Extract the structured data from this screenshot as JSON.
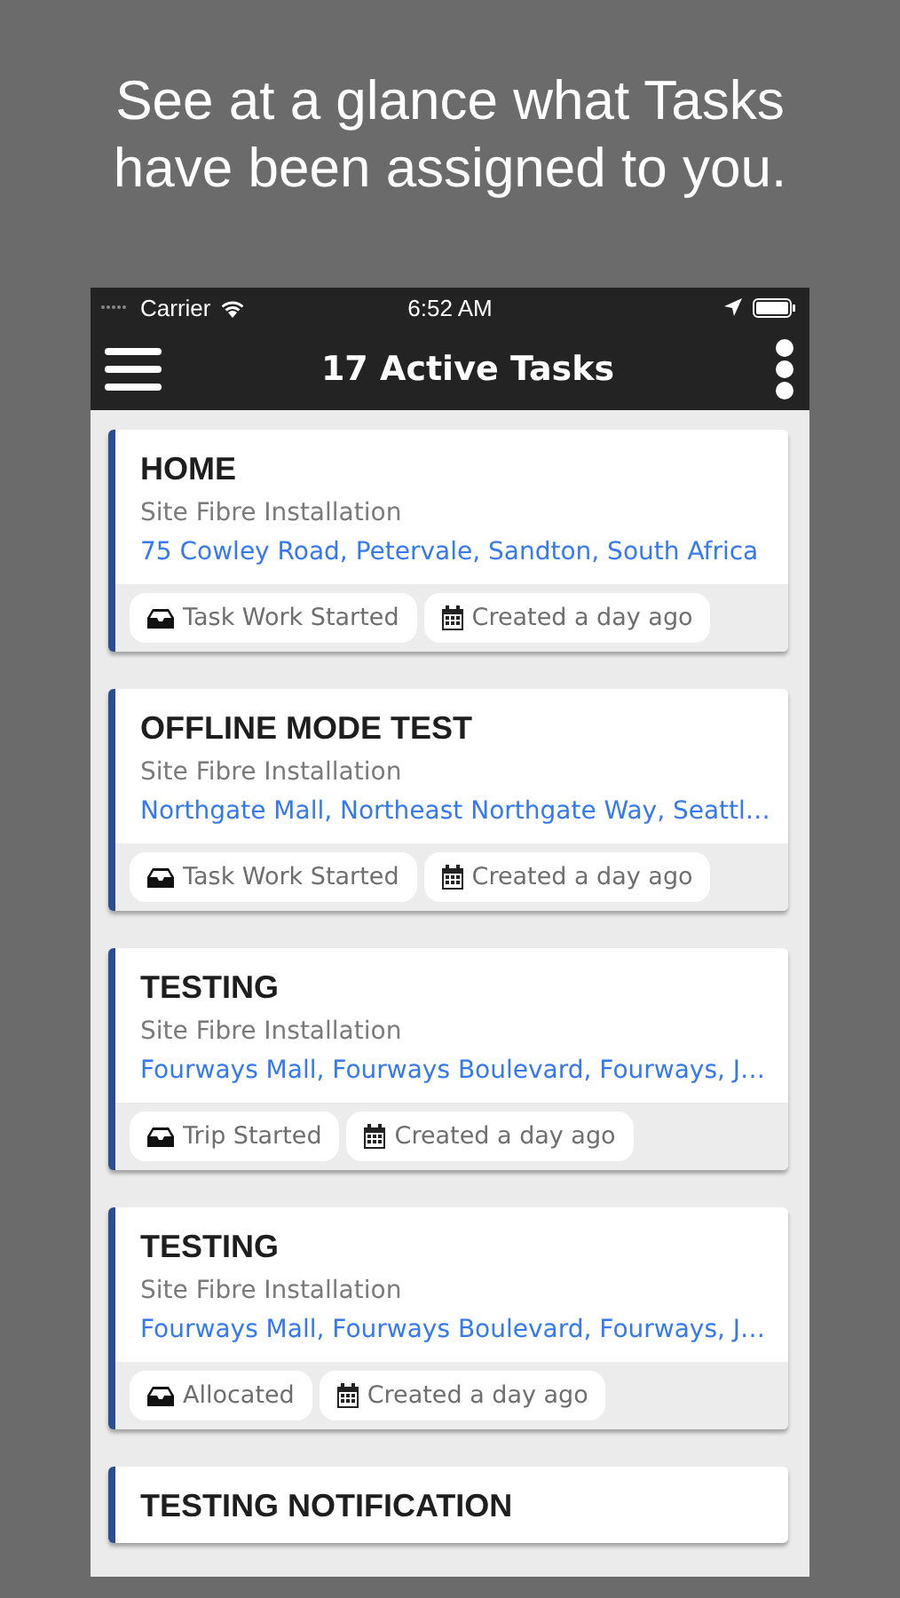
{
  "headline": "See at a glance what Tasks have been assigned to you.",
  "status_bar": {
    "carrier": "Carrier",
    "time": "6:52 AM"
  },
  "nav_bar": {
    "title": "17 Active Tasks"
  },
  "tasks": [
    {
      "title": "HOME",
      "type": "Site Fibre Installation",
      "address": "75 Cowley Road, Petervale, Sandton, South Africa",
      "status": "Task Work Started",
      "created": "Created a day ago"
    },
    {
      "title": "OFFLINE MODE TEST",
      "type": "Site Fibre Installation",
      "address": "Northgate Mall, Northeast Northgate Way, Seattl…",
      "status": "Task Work Started",
      "created": "Created a day ago"
    },
    {
      "title": "TESTING",
      "type": "Site Fibre Installation",
      "address": "Fourways Mall, Fourways Boulevard, Fourways, J…",
      "status": "Trip Started",
      "created": "Created a day ago"
    },
    {
      "title": "TESTING",
      "type": "Site Fibre Installation",
      "address": "Fourways Mall, Fourways Boulevard, Fourways, J…",
      "status": "Allocated",
      "created": "Created a day ago"
    },
    {
      "title": "TESTING NOTIFICATION"
    }
  ]
}
